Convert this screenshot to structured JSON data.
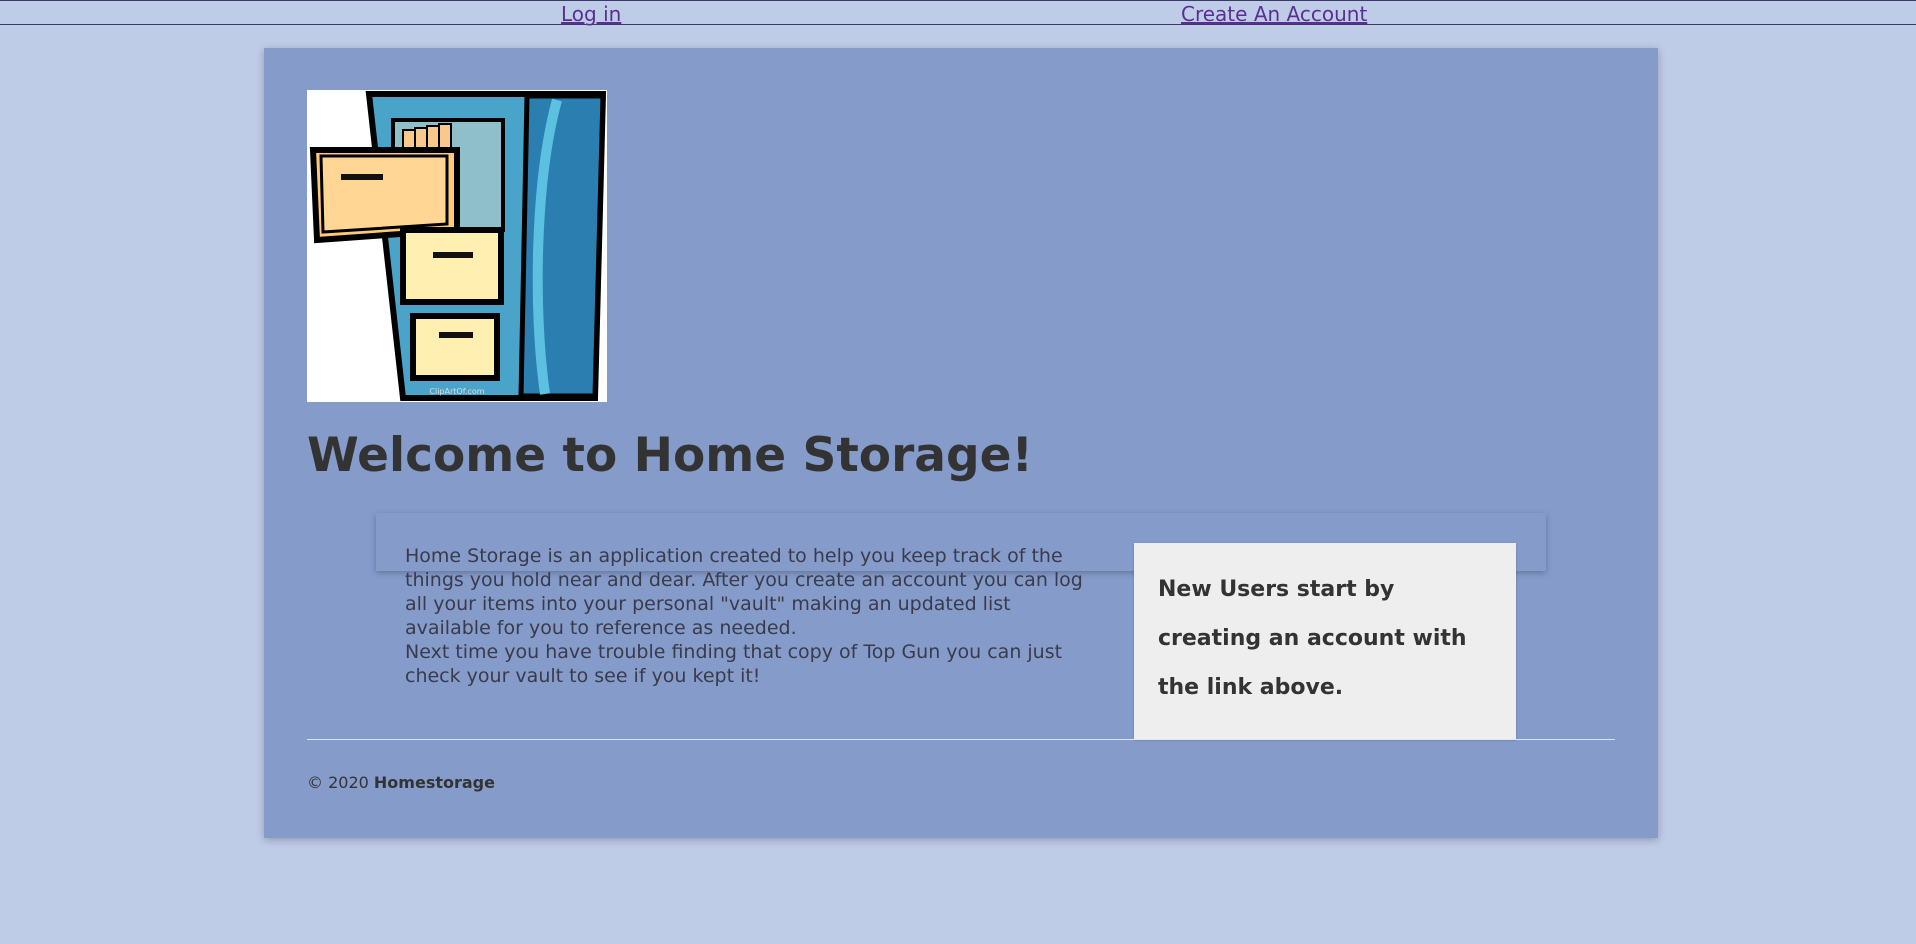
{
  "nav": {
    "login_label": "Log in",
    "create_account_label": "Create An Account"
  },
  "logo": {
    "icon": "filing-cabinet-icon",
    "watermark_text": "ClipArtOf.com"
  },
  "main": {
    "title": "Welcome to Home Storage!",
    "intro_paragraph_1": "Home Storage is an application created to help you keep track of the things you hold near and dear. After you create an account you can log all your items into your personal \"vault\" making an updated list available for you to reference as needed.",
    "intro_paragraph_2": "Next time you have trouble finding that copy of Top Gun you can just check your vault to see if you kept it!",
    "callout_text": "New Users start by creating an account with the link above."
  },
  "footer": {
    "copyright": "© 2020",
    "brand": "Homestorage"
  },
  "colors": {
    "page_background": "#bfcce8",
    "card_background": "#859ccb",
    "link": "#5b2f91",
    "callout_background": "#eeeeee",
    "text": "#333333"
  }
}
